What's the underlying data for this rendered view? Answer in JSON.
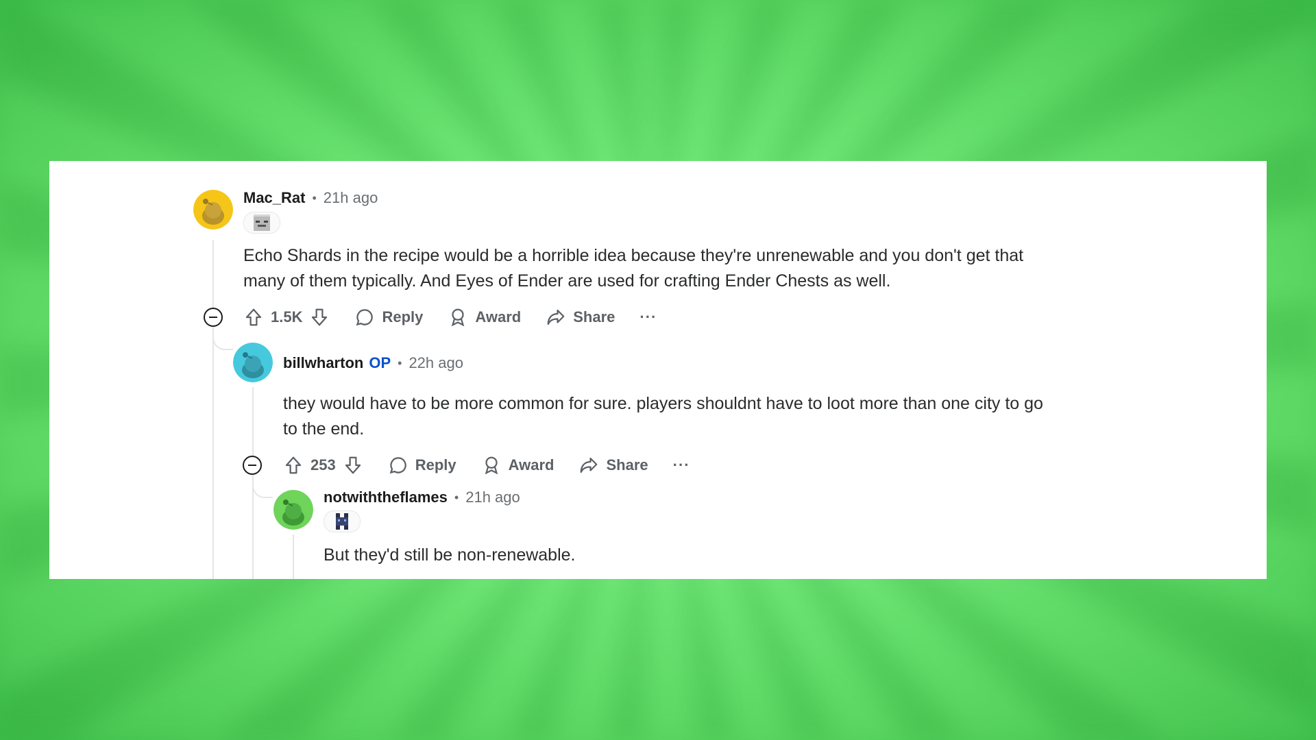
{
  "comments": [
    {
      "author": "Mac_Rat",
      "time": "21h ago",
      "body_lines": [
        "Echo Shards in the recipe would be a horrible idea because they're unrenewable and you don't get that",
        "many of them typically. And Eyes of Ender are used for crafting Ender Chests as well."
      ],
      "votes": "1.5K",
      "avatar_color": "#f5c518"
    },
    {
      "author": "billwharton",
      "op_label": "OP",
      "time": "22h ago",
      "body_lines": [
        "they would have to be more common for sure. players shouldnt have to loot more than one city to go",
        "to the end."
      ],
      "votes": "253",
      "avatar_color": "#46c9dd"
    },
    {
      "author": "notwiththeflames",
      "time": "21h ago",
      "body_lines": [
        "But they'd still be non-renewable."
      ],
      "avatar_color": "#6ed45a"
    }
  ],
  "actions": {
    "reply": "Reply",
    "award": "Award",
    "share": "Share",
    "more": "···"
  },
  "colors": {
    "background": "#6fe877",
    "card": "#ffffff",
    "op": "#0a52c9"
  }
}
